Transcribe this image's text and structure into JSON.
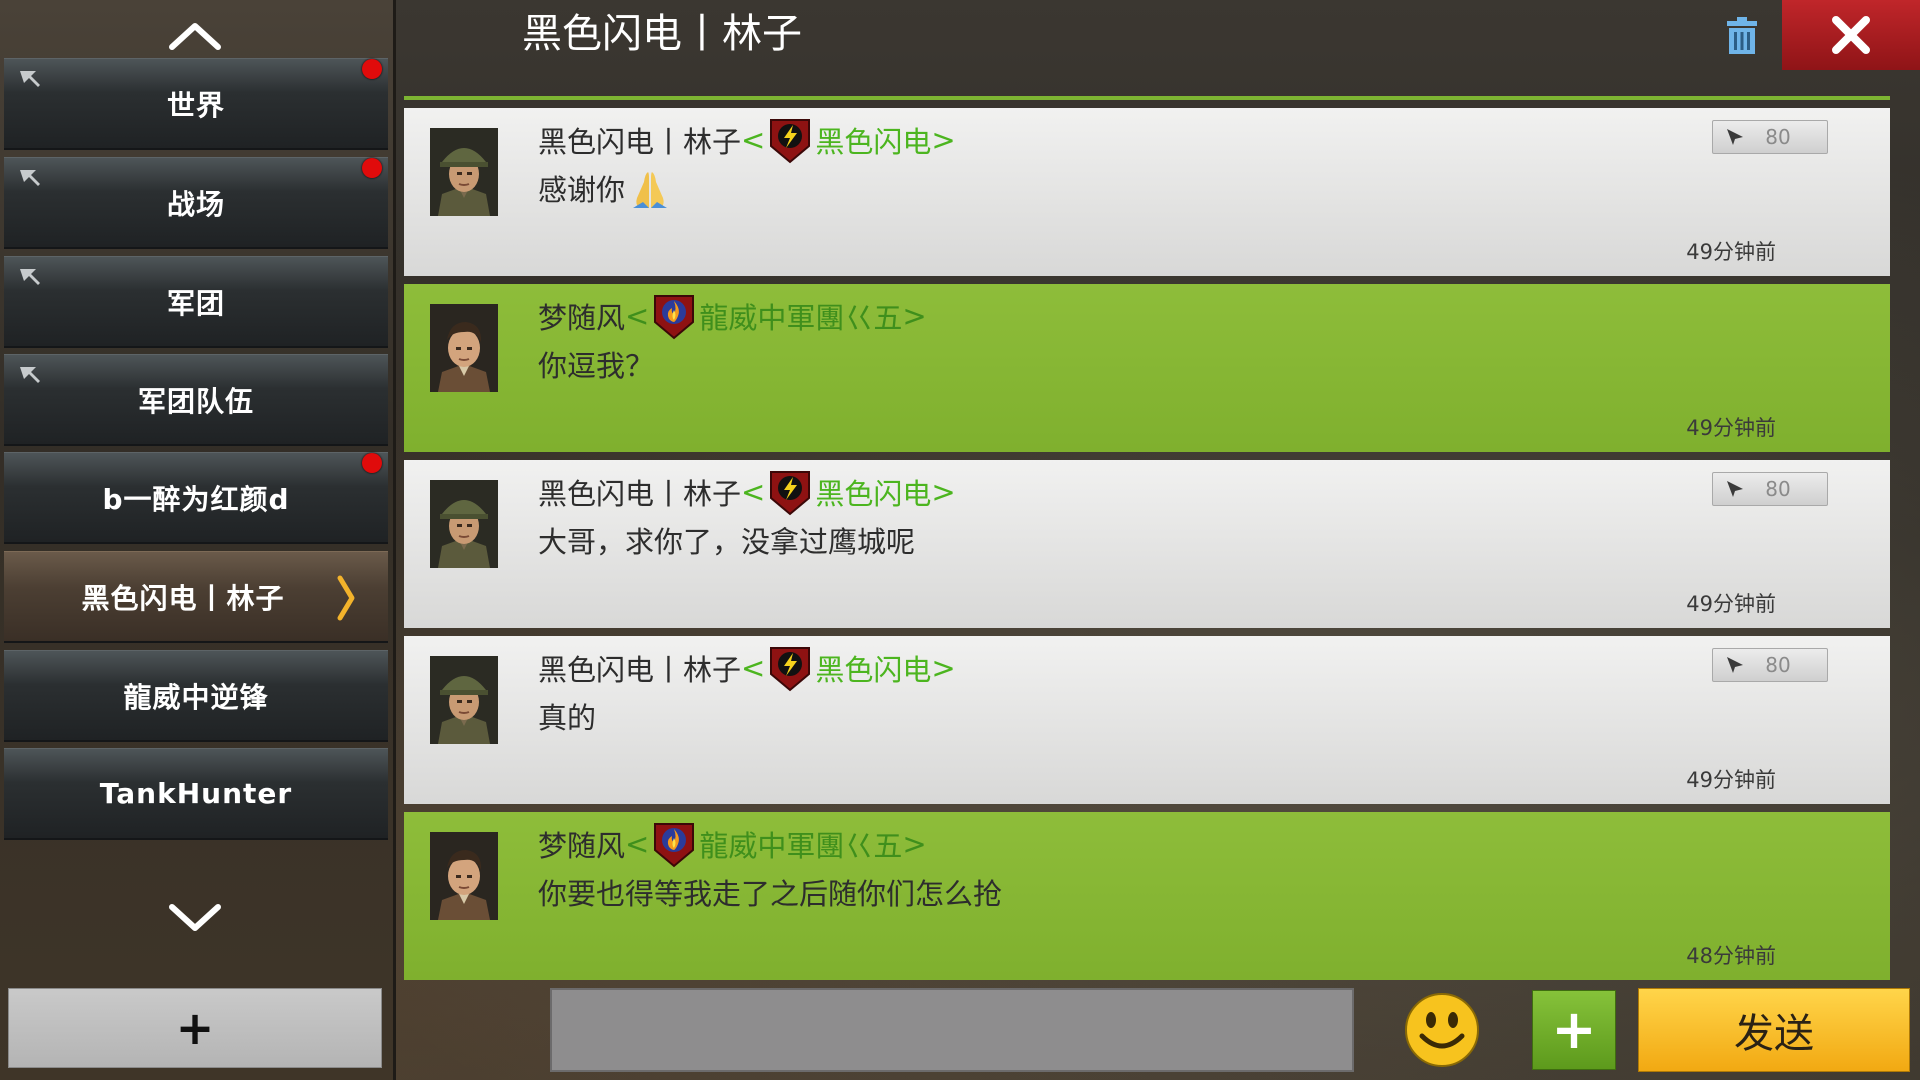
{
  "header": {
    "title": "黑色闪电丨林子",
    "trash_icon": "trash-icon",
    "close_icon": "close-icon",
    "colors": {
      "close_bg": "#b31f23",
      "accent_line": "#7db432"
    }
  },
  "sidebar": {
    "up_icon": "chevron-up-icon",
    "down_icon": "chevron-down-icon",
    "add_label": "+",
    "channels": [
      {
        "label": "世界",
        "pinned": true,
        "unread": true,
        "active": false
      },
      {
        "label": "战场",
        "pinned": true,
        "unread": true,
        "active": false
      },
      {
        "label": "军团",
        "pinned": true,
        "unread": false,
        "active": false
      },
      {
        "label": "军团队伍",
        "pinned": true,
        "unread": false,
        "active": false
      },
      {
        "label": "b一醉为红颜d",
        "pinned": false,
        "unread": true,
        "active": false
      },
      {
        "label": "黑色闪电丨林子",
        "pinned": false,
        "unread": false,
        "active": true
      },
      {
        "label": "龍威中逆锋",
        "pinned": false,
        "unread": false,
        "active": false
      },
      {
        "label": "TankHunter",
        "pinned": false,
        "unread": false,
        "active": false
      }
    ]
  },
  "messages": [
    {
      "sender": "黑色闪电丨林子",
      "open": "<",
      "guild": "黑色闪电",
      "close": ">",
      "text": "感谢你",
      "emoji": "folded-hands-icon",
      "time": "49分钟前",
      "rank": "80",
      "style": "gray"
    },
    {
      "sender": "梦随风",
      "open": "<",
      "guild": "龍威中軍團巜五",
      "close": ">",
      "text": "你逗我？",
      "time": "49分钟前",
      "style": "green"
    },
    {
      "sender": "黑色闪电丨林子",
      "open": "<",
      "guild": "黑色闪电",
      "close": ">",
      "text": "大哥，求你了，没拿过鹰城呢",
      "time": "49分钟前",
      "rank": "80",
      "style": "gray"
    },
    {
      "sender": "黑色闪电丨林子",
      "open": "<",
      "guild": "黑色闪电",
      "close": ">",
      "text": "真的",
      "time": "49分钟前",
      "rank": "80",
      "style": "gray"
    },
    {
      "sender": "梦随风",
      "open": "<",
      "guild": "龍威中軍團巜五",
      "close": ">",
      "text": "你要也得等我走了之后随你们怎么抢",
      "time": "48分钟前",
      "style": "green"
    }
  ],
  "input": {
    "value": "",
    "placeholder": "",
    "emoji_icon": "smiley-icon",
    "attach_label": "+",
    "send_label": "发送",
    "colors": {
      "send_bg": "#f8c22a",
      "attach_bg": "#74b02c"
    }
  }
}
